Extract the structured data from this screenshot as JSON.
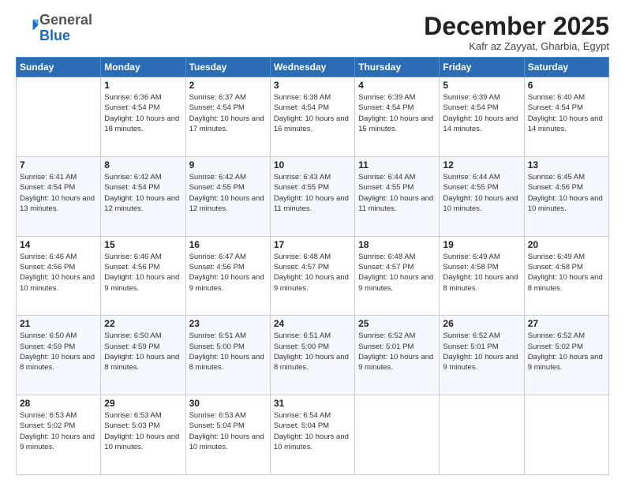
{
  "header": {
    "logo_general": "General",
    "logo_blue": "Blue",
    "month_title": "December 2025",
    "subtitle": "Kafr az Zayyat, Gharbia, Egypt"
  },
  "days_of_week": [
    "Sunday",
    "Monday",
    "Tuesday",
    "Wednesday",
    "Thursday",
    "Friday",
    "Saturday"
  ],
  "weeks": [
    [
      {
        "day": "",
        "info": ""
      },
      {
        "day": "1",
        "info": "Sunrise: 6:36 AM\nSunset: 4:54 PM\nDaylight: 10 hours\nand 18 minutes."
      },
      {
        "day": "2",
        "info": "Sunrise: 6:37 AM\nSunset: 4:54 PM\nDaylight: 10 hours\nand 17 minutes."
      },
      {
        "day": "3",
        "info": "Sunrise: 6:38 AM\nSunset: 4:54 PM\nDaylight: 10 hours\nand 16 minutes."
      },
      {
        "day": "4",
        "info": "Sunrise: 6:39 AM\nSunset: 4:54 PM\nDaylight: 10 hours\nand 15 minutes."
      },
      {
        "day": "5",
        "info": "Sunrise: 6:39 AM\nSunset: 4:54 PM\nDaylight: 10 hours\nand 14 minutes."
      },
      {
        "day": "6",
        "info": "Sunrise: 6:40 AM\nSunset: 4:54 PM\nDaylight: 10 hours\nand 14 minutes."
      }
    ],
    [
      {
        "day": "7",
        "info": "Sunrise: 6:41 AM\nSunset: 4:54 PM\nDaylight: 10 hours\nand 13 minutes."
      },
      {
        "day": "8",
        "info": "Sunrise: 6:42 AM\nSunset: 4:54 PM\nDaylight: 10 hours\nand 12 minutes."
      },
      {
        "day": "9",
        "info": "Sunrise: 6:42 AM\nSunset: 4:55 PM\nDaylight: 10 hours\nand 12 minutes."
      },
      {
        "day": "10",
        "info": "Sunrise: 6:43 AM\nSunset: 4:55 PM\nDaylight: 10 hours\nand 11 minutes."
      },
      {
        "day": "11",
        "info": "Sunrise: 6:44 AM\nSunset: 4:55 PM\nDaylight: 10 hours\nand 11 minutes."
      },
      {
        "day": "12",
        "info": "Sunrise: 6:44 AM\nSunset: 4:55 PM\nDaylight: 10 hours\nand 10 minutes."
      },
      {
        "day": "13",
        "info": "Sunrise: 6:45 AM\nSunset: 4:56 PM\nDaylight: 10 hours\nand 10 minutes."
      }
    ],
    [
      {
        "day": "14",
        "info": "Sunrise: 6:46 AM\nSunset: 4:56 PM\nDaylight: 10 hours\nand 10 minutes."
      },
      {
        "day": "15",
        "info": "Sunrise: 6:46 AM\nSunset: 4:56 PM\nDaylight: 10 hours\nand 9 minutes."
      },
      {
        "day": "16",
        "info": "Sunrise: 6:47 AM\nSunset: 4:56 PM\nDaylight: 10 hours\nand 9 minutes."
      },
      {
        "day": "17",
        "info": "Sunrise: 6:48 AM\nSunset: 4:57 PM\nDaylight: 10 hours\nand 9 minutes."
      },
      {
        "day": "18",
        "info": "Sunrise: 6:48 AM\nSunset: 4:57 PM\nDaylight: 10 hours\nand 9 minutes."
      },
      {
        "day": "19",
        "info": "Sunrise: 6:49 AM\nSunset: 4:58 PM\nDaylight: 10 hours\nand 8 minutes."
      },
      {
        "day": "20",
        "info": "Sunrise: 6:49 AM\nSunset: 4:58 PM\nDaylight: 10 hours\nand 8 minutes."
      }
    ],
    [
      {
        "day": "21",
        "info": "Sunrise: 6:50 AM\nSunset: 4:59 PM\nDaylight: 10 hours\nand 8 minutes."
      },
      {
        "day": "22",
        "info": "Sunrise: 6:50 AM\nSunset: 4:59 PM\nDaylight: 10 hours\nand 8 minutes."
      },
      {
        "day": "23",
        "info": "Sunrise: 6:51 AM\nSunset: 5:00 PM\nDaylight: 10 hours\nand 8 minutes."
      },
      {
        "day": "24",
        "info": "Sunrise: 6:51 AM\nSunset: 5:00 PM\nDaylight: 10 hours\nand 8 minutes."
      },
      {
        "day": "25",
        "info": "Sunrise: 6:52 AM\nSunset: 5:01 PM\nDaylight: 10 hours\nand 9 minutes."
      },
      {
        "day": "26",
        "info": "Sunrise: 6:52 AM\nSunset: 5:01 PM\nDaylight: 10 hours\nand 9 minutes."
      },
      {
        "day": "27",
        "info": "Sunrise: 6:52 AM\nSunset: 5:02 PM\nDaylight: 10 hours\nand 9 minutes."
      }
    ],
    [
      {
        "day": "28",
        "info": "Sunrise: 6:53 AM\nSunset: 5:02 PM\nDaylight: 10 hours\nand 9 minutes."
      },
      {
        "day": "29",
        "info": "Sunrise: 6:53 AM\nSunset: 5:03 PM\nDaylight: 10 hours\nand 10 minutes."
      },
      {
        "day": "30",
        "info": "Sunrise: 6:53 AM\nSunset: 5:04 PM\nDaylight: 10 hours\nand 10 minutes."
      },
      {
        "day": "31",
        "info": "Sunrise: 6:54 AM\nSunset: 5:04 PM\nDaylight: 10 hours\nand 10 minutes."
      },
      {
        "day": "",
        "info": ""
      },
      {
        "day": "",
        "info": ""
      },
      {
        "day": "",
        "info": ""
      }
    ]
  ]
}
